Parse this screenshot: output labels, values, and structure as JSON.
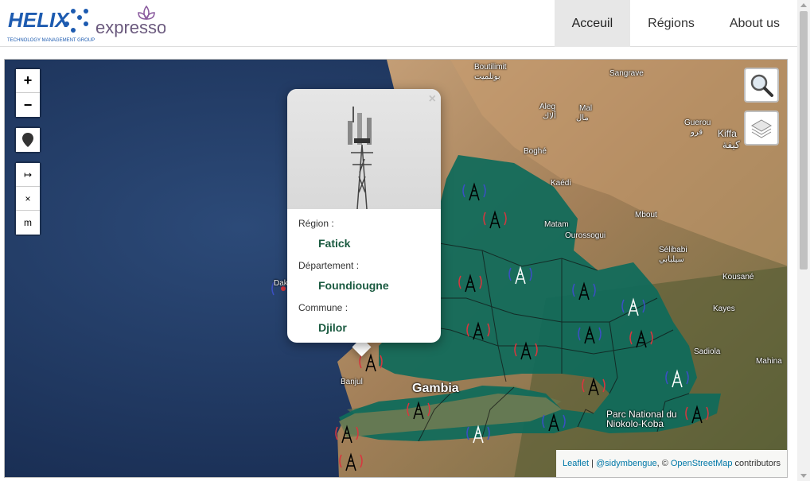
{
  "brand": {
    "helix_name": "HELIX",
    "helix_tagline": "TECHNOLOGY MANAGEMENT GROUP",
    "expresso_name": "expresso",
    "helix_color": "#1d5bb0",
    "expresso_color": "#8a5a9e"
  },
  "nav": {
    "items": [
      {
        "label": "Acceuil",
        "active": true
      },
      {
        "label": "Régions",
        "active": false
      },
      {
        "label": "About us",
        "active": false
      }
    ]
  },
  "map": {
    "controls": {
      "zoom_in": "+",
      "zoom_out": "−",
      "marker_icon": "map-pin-icon",
      "measure_icon": "↦",
      "clear_icon": "×",
      "units": "m",
      "search_icon": "magnifier-icon",
      "layers_icon": "layers-icon"
    },
    "places": [
      "Boutilimit",
      "بوتلميت",
      "Sangrave",
      "Aleg",
      "ألاك",
      "Mal",
      "مال",
      "Guerou",
      "قرو",
      "Kiffa",
      "كيفة",
      "Boghé",
      "Kaédi",
      "Mbout",
      "Sélibabi",
      "سيلبابي",
      "Ourossogui",
      "Matam",
      "Kayes",
      "Kousané",
      "Sadiola",
      "Mahina",
      "Banjul",
      "Gambia",
      "Parc National du Niokolo-Koba",
      "Dakar"
    ],
    "polygon_color": "#0f6b5a",
    "antenna_colors": [
      "#d9363e",
      "#3b4fc4"
    ],
    "attribution": {
      "leaflet": "Leaflet",
      "author": "@sidymbengue",
      "copyright": ", ©",
      "osm": "OpenStreetMap",
      "contributors": " contributors",
      "separator": " | "
    }
  },
  "popup": {
    "close": "×",
    "image": "cell-tower-image",
    "fields": [
      {
        "label": "Région :",
        "value": "Fatick"
      },
      {
        "label": "Département :",
        "value": "Foundiougne"
      },
      {
        "label": "Commune :",
        "value": "Djilor"
      }
    ]
  }
}
